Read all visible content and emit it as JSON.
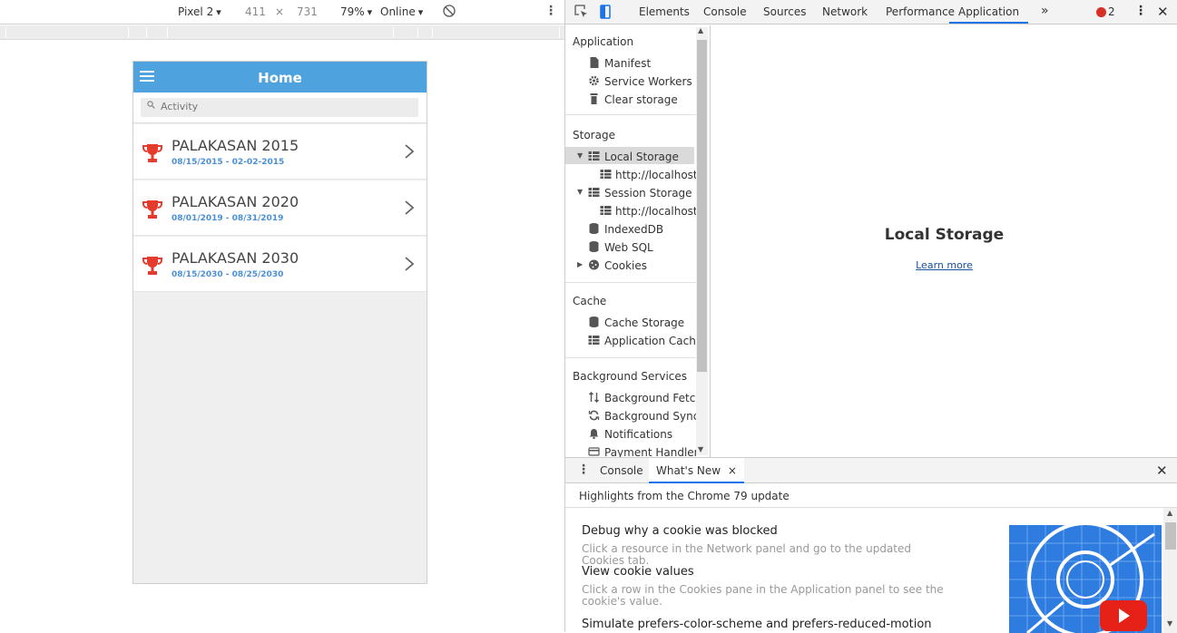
{
  "device_toolbar": {
    "device": "Pixel 2",
    "width": "411",
    "times": "×",
    "height": "731",
    "zoom": "79%",
    "network": "Online"
  },
  "app": {
    "title": "Home",
    "search_placeholder": "Activity",
    "accent_color": "#4ea3de",
    "items": [
      {
        "title": "PALAKASAN 2015",
        "dates": "08/15/2015 - 02-02-2015"
      },
      {
        "title": "PALAKASAN 2020",
        "dates": "08/01/2019 - 08/31/2019"
      },
      {
        "title": "PALAKASAN 2030",
        "dates": "08/15/2030 - 08/25/2030"
      }
    ]
  },
  "devtools": {
    "tabs": [
      "Elements",
      "Console",
      "Sources",
      "Network",
      "Performance",
      "Application"
    ],
    "active_tab": "Application",
    "more": "»",
    "error_count": "2",
    "sidebar": {
      "application_heading": "Application",
      "application_items": [
        "Manifest",
        "Service Workers",
        "Clear storage"
      ],
      "storage_heading": "Storage",
      "local_storage": "Local Storage",
      "local_storage_child": "http://localhost",
      "session_storage": "Session Storage",
      "session_storage_child": "http://localhost",
      "storage_items": [
        "IndexedDB",
        "Web SQL",
        "Cookies"
      ],
      "cache_heading": "Cache",
      "cache_items": [
        "Cache Storage",
        "Application Cache"
      ],
      "bg_heading": "Background Services",
      "bg_items": [
        "Background Fetch",
        "Background Sync",
        "Notifications",
        "Payment Handler"
      ]
    },
    "main": {
      "title": "Local Storage",
      "link": "Learn more"
    },
    "drawer": {
      "tabs": [
        "Console",
        "What's New"
      ],
      "close": "×",
      "header": "Highlights from the Chrome 79 update",
      "entries": [
        {
          "title": "Debug why a cookie was blocked",
          "desc": "Click a resource in the Network panel and go to the updated Cookies tab."
        },
        {
          "title": "View cookie values",
          "desc": "Click a row in the Cookies pane in the Application panel to see the cookie's value."
        },
        {
          "title": "Simulate prefers-color-scheme and prefers-reduced-motion",
          "desc": ""
        }
      ]
    }
  }
}
